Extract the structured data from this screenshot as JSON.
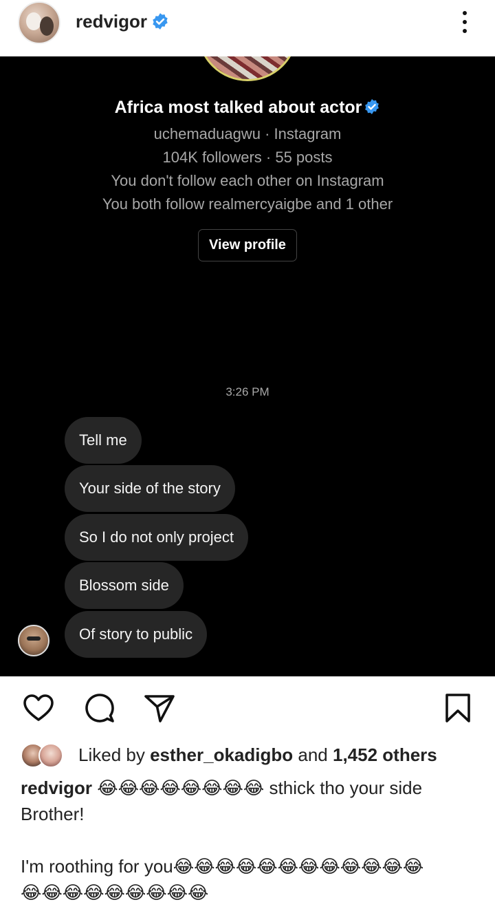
{
  "post": {
    "username": "redvigor",
    "verified": true,
    "more_icon": "more-vertical-icon"
  },
  "dm": {
    "display_name": "Africa most talked about actor",
    "handle_line": "uchemaduagwu · Instagram",
    "stats_line": "104K followers · 55 posts",
    "follow_status": "You don't follow each other on Instagram",
    "mutuals": "You both follow realmercyaigbe and 1 other",
    "view_profile_label": "View profile",
    "timestamp": "3:26 PM",
    "messages": [
      "Tell me",
      "Your side of the story",
      "So I do not only project",
      "Blossom side",
      "Of story to public"
    ]
  },
  "actions": {
    "like_icon": "heart-icon",
    "comment_icon": "comment-icon",
    "share_icon": "send-icon",
    "save_icon": "bookmark-icon"
  },
  "likes": {
    "prefix": "Liked by",
    "user": "esther_okadigbo",
    "and": "and",
    "count": "1,452 others"
  },
  "caption": {
    "username": "redvigor",
    "line1_text": "😂😂😂😂😂😂😂😂 sthick tho your side",
    "line2": "Brother!",
    "line3": "",
    "line4": "I'm roothing for you😂😂😂😂😂😂😂😂😂😂😂😂",
    "line5": "😂😂😂😂😂😂😂😂😂"
  },
  "colors": {
    "dm_background": "#000000",
    "bubble": "#262626",
    "verified_blue": "#3897f0",
    "muted_text": "#a8a8a8"
  }
}
